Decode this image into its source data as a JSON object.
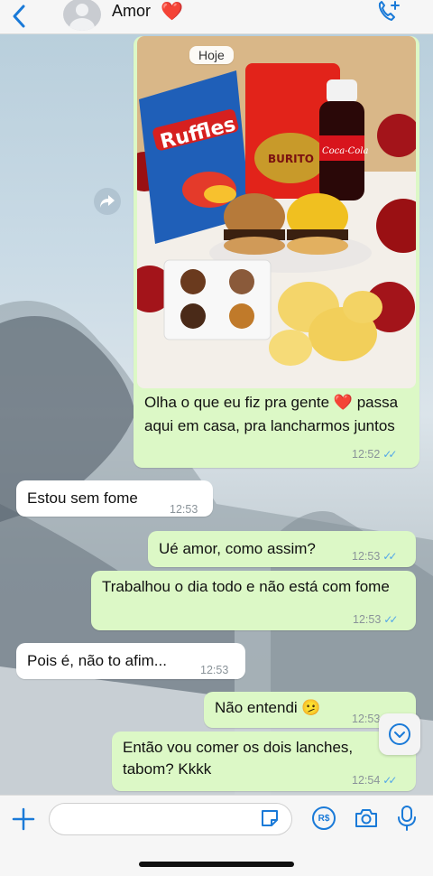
{
  "header": {
    "contact_name": "Amor",
    "contact_emoji": "❤️",
    "icons": [
      "back-chevron-icon",
      "avatar",
      "call-add-icon"
    ]
  },
  "date_pill": "Hoje",
  "photo_message": {
    "caption": "Olha o que eu fiz pra gente ❤️ passa aqui em casa, pra lancharmos juntos",
    "time": "12:52",
    "photo_text": {
      "chips_brand": "Ruffles",
      "box_brand": "BURITO",
      "soda_brand": "Coca-Cola"
    }
  },
  "messages": [
    {
      "direction": "in",
      "text": "Estou sem fome",
      "time": "12:53"
    },
    {
      "direction": "out",
      "text": "Ué amor, como assim?",
      "time": "12:53"
    },
    {
      "direction": "out",
      "text": "Trabalhou o dia todo e não está com fome",
      "time": "12:53"
    },
    {
      "direction": "in",
      "text": "Pois é, não to afim...",
      "time": "12:53"
    },
    {
      "direction": "out",
      "text": "Não entendi 🫤",
      "time": "12:53"
    },
    {
      "direction": "out",
      "text": "Então vou comer os dois lanches, tabom? Kkkk",
      "time": "12:54"
    }
  ],
  "input": {
    "placeholder": ""
  },
  "colors": {
    "outgoing_bubble": "#dcf8c6",
    "incoming_bubble": "#ffffff",
    "accent": "#1a7ad8",
    "read_ticks": "#53a7e8"
  }
}
